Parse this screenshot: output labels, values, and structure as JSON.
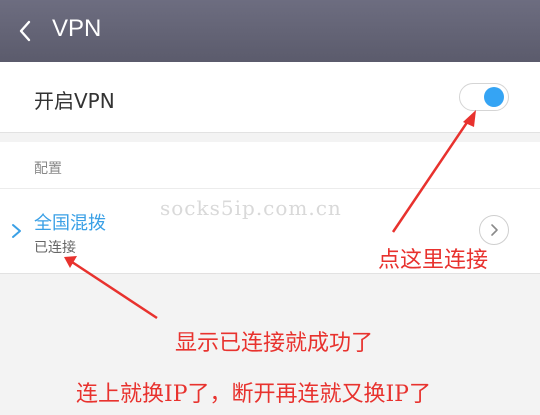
{
  "header": {
    "title": "VPN",
    "back_icon": "chevron-left-icon"
  },
  "vpn_toggle": {
    "label": "开启VPN",
    "state": "on",
    "accent": "#35a4f4"
  },
  "config": {
    "section_label": "配置",
    "profile": {
      "name": "全国混拨",
      "status": "已连接",
      "detail_icon": "chevron-right-icon"
    }
  },
  "watermark": "socks5ip.com.cn",
  "annotations": {
    "click_here": "点这里连接",
    "connected_success": "显示已连接就成功了",
    "ip_change": "连上就换IP了，断开再连就又换IP了",
    "color": "#e8322e"
  }
}
